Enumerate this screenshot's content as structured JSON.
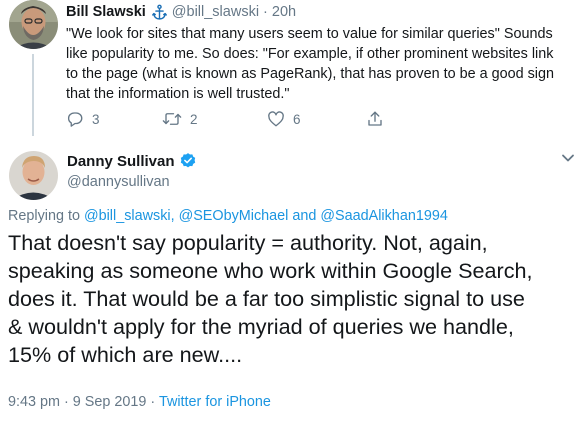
{
  "parent_tweet": {
    "name": "Bill Slawski",
    "handle": "@bill_slawski",
    "separator": "·",
    "time": "20h",
    "text_lines": [
      "\"We look for sites that many users seem to value for similar queries\"  Sounds",
      "like popularity to me. So does: \"For example, if other prominent websites link",
      "to the page (what is known as PageRank), that has proven to be a good sign",
      "that the information is well trusted.\""
    ],
    "reply_count": "3",
    "retweet_count": "2",
    "like_count": "6"
  },
  "main_tweet": {
    "name": "Danny Sullivan",
    "handle": "@dannysullivan",
    "replying_to": {
      "prefix": "Replying to ",
      "users": [
        "@bill_slawski",
        "@SEObyMichael",
        "@SaadAlikhan1994"
      ],
      "separator": ", ",
      "conjunction": " and "
    },
    "text_lines": [
      "That doesn't say popularity = authority. Not, again,",
      "speaking as someone who work within Google Search,",
      "does it. That would be a far too simplistic signal to use",
      "& wouldn't apply for the myriad of queries we handle,",
      "15% of which are new...."
    ],
    "time": "9:43 pm",
    "date": "9 Sep 2019",
    "meta_separator": " · ",
    "source": "Twitter for iPhone"
  },
  "colors": {
    "text": "#14171a",
    "secondary": "#657786",
    "link": "#1b95e0",
    "verified": "#1da1f2",
    "thread_line": "#ccd6dd"
  },
  "icons": {
    "author_badge": "anchor-icon",
    "verified": "verified-badge-icon",
    "reply": "reply-icon",
    "retweet": "retweet-icon",
    "like": "heart-icon",
    "share": "share-icon",
    "menu": "chevron-down-icon"
  }
}
